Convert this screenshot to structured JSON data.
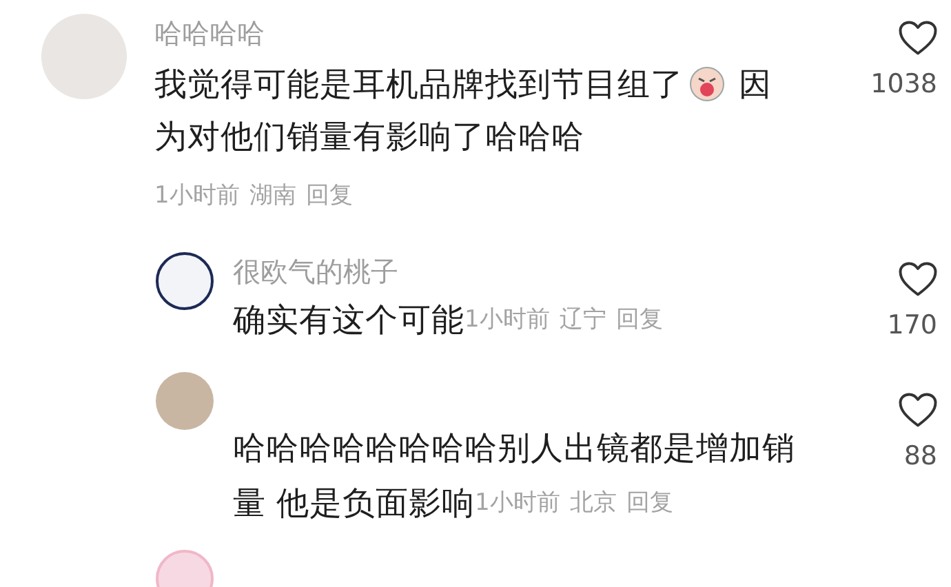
{
  "comment": {
    "author": "哈哈哈哈",
    "line1_before_emoji": "我觉得可能是耳机品牌找到节目组了",
    "line1_after_emoji": "因",
    "line2": "为对他们销量有影响了哈哈哈",
    "time": "1小时前",
    "location": "湖南",
    "reply_label": "回复",
    "likes": "1038"
  },
  "replies": [
    {
      "kind": "cartoon",
      "author": "很欧气的桃子",
      "text_lines": [
        "确实有这个可能"
      ],
      "time": "1小时前",
      "location": "辽宁",
      "reply_label": "回复",
      "likes": "170"
    },
    {
      "kind": "photo",
      "text_lines": [
        "哈哈哈哈哈哈哈哈别人出镜都是增加销",
        "量 他是负面影响"
      ],
      "time": "1小时前",
      "location": "北京",
      "reply_label": "回复",
      "likes": "88"
    }
  ]
}
